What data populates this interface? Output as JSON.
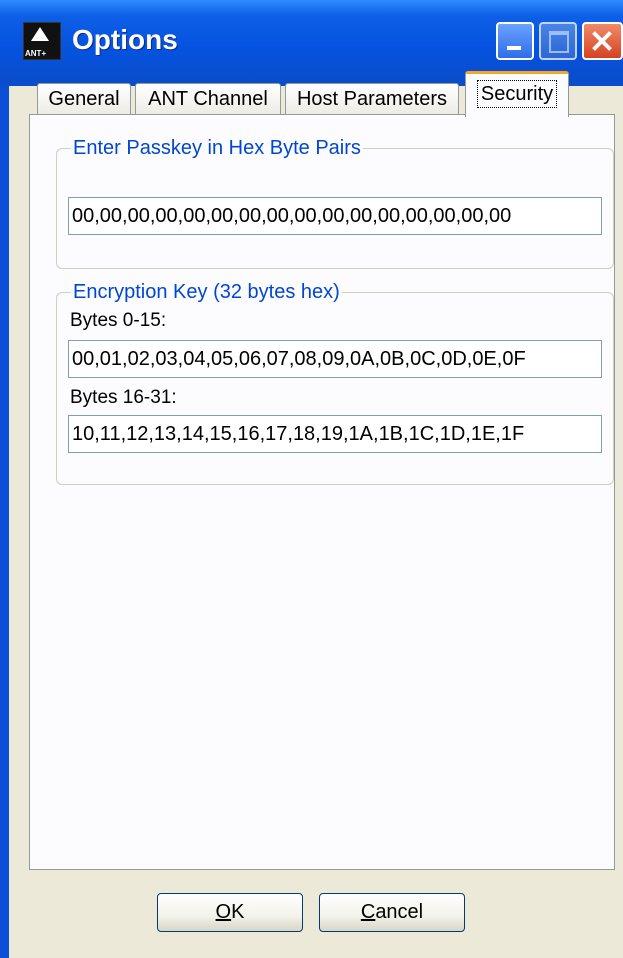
{
  "window": {
    "title": "Options"
  },
  "tabs": [
    {
      "label": "General"
    },
    {
      "label": "ANT Channel"
    },
    {
      "label": "Host Parameters"
    },
    {
      "label": "Security",
      "active": true
    }
  ],
  "passkey": {
    "legend": "Enter Passkey in Hex Byte Pairs",
    "value": "00,00,00,00,00,00,00,00,00,00,00,00,00,00,00,00"
  },
  "encryption": {
    "legend": "Encryption Key (32 bytes hex)",
    "bytes_0_15_label": "Bytes 0-15:",
    "bytes_0_15_value": "00,01,02,03,04,05,06,07,08,09,0A,0B,0C,0D,0E,0F",
    "bytes_16_31_label": "Bytes 16-31:",
    "bytes_16_31_value": "10,11,12,13,14,15,16,17,18,19,1A,1B,1C,1D,1E,1F"
  },
  "buttons": {
    "ok_mnemonic": "O",
    "ok_rest": "K",
    "cancel_mnemonic": "C",
    "cancel_rest": "ancel"
  },
  "icons": {
    "app": "ant-plus-logo-icon"
  },
  "colors": {
    "titlebar": "#0553e0",
    "legend_text": "#0046d5",
    "active_tab_accent": "#f5a623",
    "close_button": "#d64220"
  }
}
